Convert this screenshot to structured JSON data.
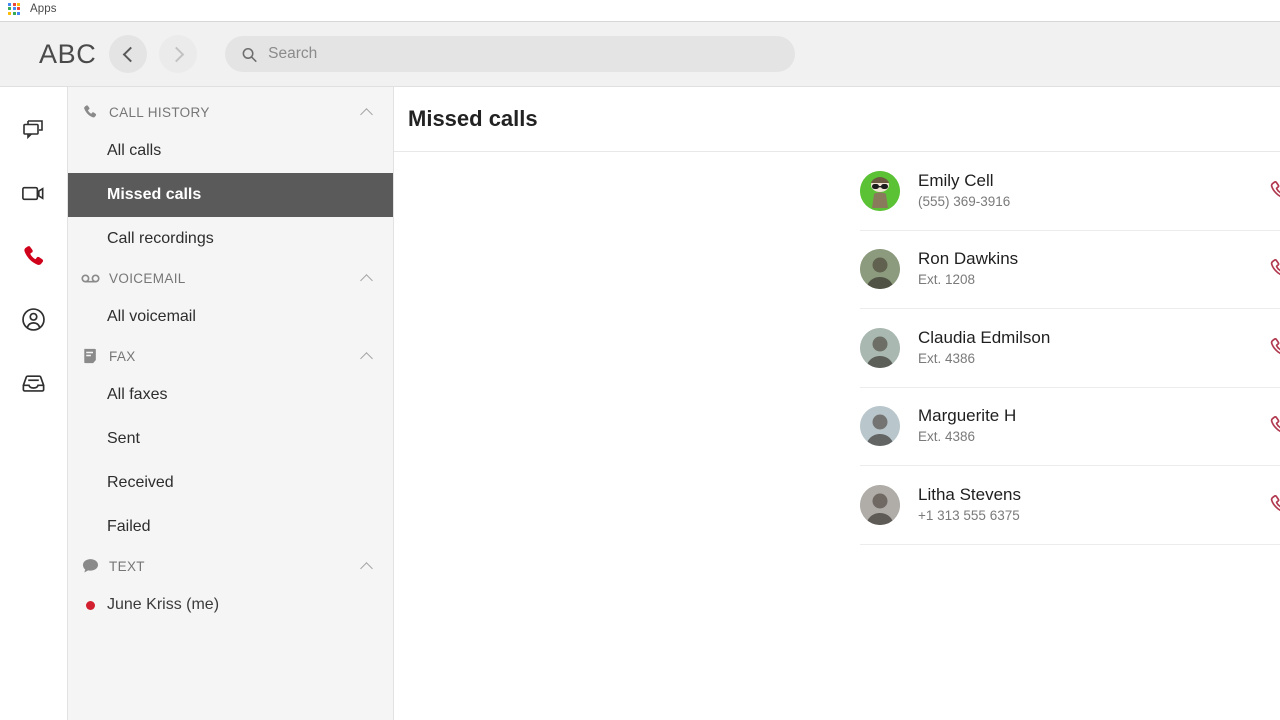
{
  "browser": {
    "bookmark_label": "Apps",
    "apps_icon": "apps-grid-icon",
    "apps_colors": [
      "#4285f4",
      "#ea4335",
      "#fbbc05",
      "#34a853",
      "#4285f4",
      "#ea4335",
      "#fbbc05",
      "#34a853",
      "#4285f4"
    ]
  },
  "header": {
    "brand": "ABC",
    "back_icon": "chevron-left-icon",
    "forward_icon": "chevron-right-icon",
    "search": {
      "icon": "search-icon",
      "placeholder": "Search",
      "value": ""
    }
  },
  "rail": {
    "items": [
      {
        "icon": "messages-icon",
        "active": false
      },
      {
        "icon": "video-camera-icon",
        "active": false
      },
      {
        "icon": "phone-icon",
        "active": true
      },
      {
        "icon": "person-circle-icon",
        "active": false
      },
      {
        "icon": "inbox-tray-icon",
        "active": false
      }
    ],
    "active_color": "#d0021b"
  },
  "sidebar": {
    "sections": [
      {
        "title": "CALL HISTORY",
        "icon": "phone-icon",
        "caret": "chevron-up-icon",
        "expanded": true,
        "items": [
          {
            "label": "All calls",
            "active": false
          },
          {
            "label": "Missed calls",
            "active": true
          },
          {
            "label": "Call recordings",
            "active": false
          }
        ]
      },
      {
        "title": "VOICEMAIL",
        "icon": "voicemail-icon",
        "caret": "chevron-up-icon",
        "expanded": true,
        "items": [
          {
            "label": "All voicemail",
            "active": false
          }
        ]
      },
      {
        "title": "FAX",
        "icon": "fax-document-icon",
        "caret": "chevron-up-icon",
        "expanded": true,
        "items": [
          {
            "label": "All faxes",
            "active": false
          },
          {
            "label": "Sent",
            "active": false
          },
          {
            "label": "Received",
            "active": false
          },
          {
            "label": "Failed",
            "active": false
          }
        ]
      },
      {
        "title": "TEXT",
        "icon": "chat-bubble-icon",
        "caret": "chevron-up-icon",
        "expanded": true,
        "items": [
          {
            "label": "June Kriss (me)",
            "active": false,
            "unread_dot": true
          }
        ]
      }
    ],
    "active_bg": "#5a5a5a",
    "unread_dot_color": "#d32030"
  },
  "main": {
    "title": "Missed calls",
    "rows": [
      {
        "name": "Emily Cell",
        "detail": "(555) 369-3916",
        "avatar": "cartoon-avatar",
        "avatar_bg": "#5bc236",
        "action_icon": "missed-call-icon"
      },
      {
        "name": "Ron Dawkins",
        "detail": "Ext. 1208",
        "avatar": "photo-avatar",
        "avatar_bg": "#8c9b7e",
        "action_icon": "missed-call-icon"
      },
      {
        "name": "Claudia Edmilson",
        "detail": "Ext. 4386",
        "avatar": "photo-avatar",
        "avatar_bg": "#a9b8b0",
        "action_icon": "missed-call-icon"
      },
      {
        "name": "Marguerite H",
        "detail": "Ext. 4386",
        "avatar": "photo-avatar",
        "avatar_bg": "#b9c7cc",
        "action_icon": "missed-call-icon"
      },
      {
        "name": "Litha Stevens",
        "detail": "+1 313 555 6375",
        "avatar": "photo-avatar",
        "avatar_bg": "#b0aca8",
        "action_icon": "missed-call-icon"
      }
    ],
    "missed_icon_color": "#b23a50"
  }
}
